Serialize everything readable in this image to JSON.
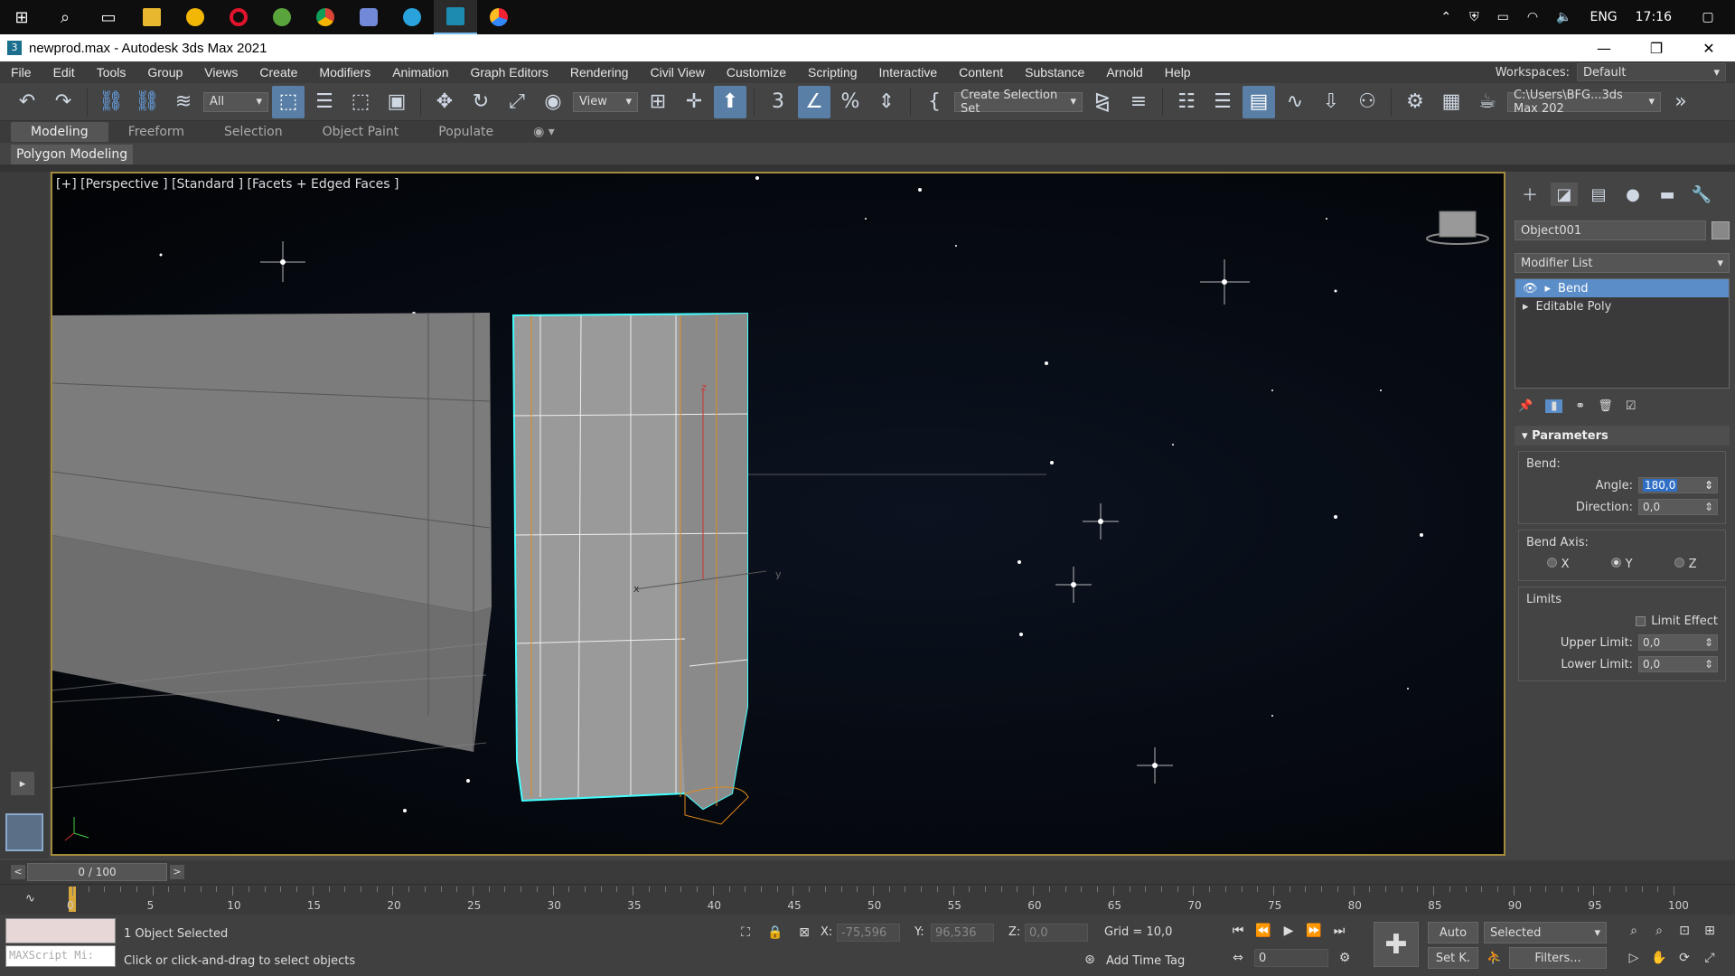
{
  "taskbar": {
    "tray": {
      "language": "ENG",
      "time": "17:16"
    }
  },
  "titlebar": {
    "title": "newprod.max - Autodesk 3ds Max 2021"
  },
  "menu": {
    "items": [
      "File",
      "Edit",
      "Tools",
      "Group",
      "Views",
      "Create",
      "Modifiers",
      "Animation",
      "Graph Editors",
      "Rendering",
      "Civil View",
      "Customize",
      "Scripting",
      "Interactive",
      "Content",
      "Substance",
      "Arnold",
      "Help"
    ],
    "workspace_label": "Workspaces:",
    "workspace_value": "Default"
  },
  "toolbar": {
    "filter_value": "All",
    "refcoord_value": "View",
    "selection_set_value": "Create Selection Set",
    "project_path": "C:\\Users\\BFG...3ds Max 202"
  },
  "ribbon": {
    "tabs": [
      "Modeling",
      "Freeform",
      "Selection",
      "Object Paint",
      "Populate"
    ],
    "sub_label": "Polygon Modeling"
  },
  "viewport": {
    "label": "[+] [Perspective ] [Standard ] [Facets + Edged Faces ]"
  },
  "command_panel": {
    "object_name": "Object001",
    "modifier_list": "Modifier List",
    "stack": [
      {
        "label": "Bend",
        "selected": true
      },
      {
        "label": "Editable Poly",
        "selected": false
      }
    ],
    "rollout_title": "Parameters",
    "bend_group": "Bend:",
    "angle_label": "Angle:",
    "angle_value": "180,0",
    "direction_label": "Direction:",
    "direction_value": "0,0",
    "bend_axis_group": "Bend Axis:",
    "axes": [
      "X",
      "Y",
      "Z"
    ],
    "selected_axis": "Y",
    "limits_group": "Limits",
    "limit_effect_label": "Limit Effect",
    "upper_limit_label": "Upper Limit:",
    "upper_limit_value": "0,0",
    "lower_limit_label": "Lower Limit:",
    "lower_limit_value": "0,0"
  },
  "timeline": {
    "frame_display": "0 / 100",
    "ticks": [
      "0",
      "5",
      "10",
      "15",
      "20",
      "25",
      "30",
      "35",
      "40",
      "45",
      "50",
      "55",
      "60",
      "65",
      "70",
      "75",
      "80",
      "85",
      "90",
      "95",
      "100"
    ]
  },
  "status": {
    "selection_count": "1 Object Selected",
    "prompt": "Click or click-and-drag to select objects",
    "maxscript_placeholder": "MAXScript Mi:",
    "x_label": "X:",
    "x_value": "-75,596",
    "y_label": "Y:",
    "y_value": "96,536",
    "z_label": "Z:",
    "z_value": "0,0",
    "grid": "Grid = 10,0",
    "add_time_tag": "Add Time Tag",
    "auto_label": "Auto",
    "selected_dropdown": "Selected",
    "setk_label": "Set K.",
    "filters_label": "Filters...",
    "frame_value": "0"
  }
}
